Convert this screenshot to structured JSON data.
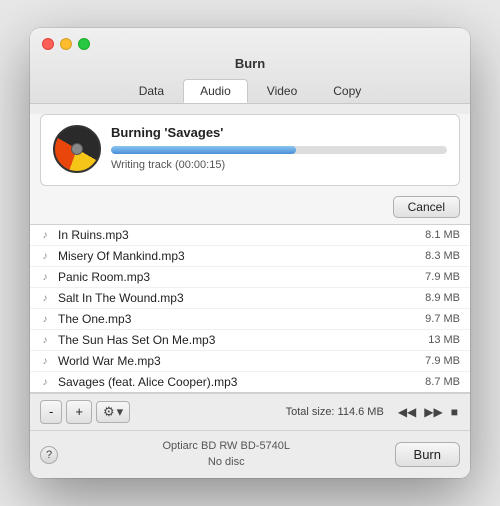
{
  "window": {
    "title": "Burn",
    "tabs": [
      {
        "id": "data",
        "label": "Data",
        "active": false
      },
      {
        "id": "audio",
        "label": "Audio",
        "active": true
      },
      {
        "id": "video",
        "label": "Video",
        "active": false
      },
      {
        "id": "copy",
        "label": "Copy",
        "active": false
      }
    ]
  },
  "burn_progress": {
    "title": "Burning 'Savages'",
    "status": "Writing track (00:00:15)",
    "progress_pct": 55,
    "cancel_label": "Cancel"
  },
  "files": [
    {
      "name": "In Ruins.mp3",
      "size": "8.1 MB"
    },
    {
      "name": "Misery Of Mankind.mp3",
      "size": "8.3 MB"
    },
    {
      "name": "Panic Room.mp3",
      "size": "7.9 MB"
    },
    {
      "name": "Salt In The Wound.mp3",
      "size": "8.9 MB"
    },
    {
      "name": "The One.mp3",
      "size": "9.7 MB"
    },
    {
      "name": "The Sun Has Set On Me.mp3",
      "size": "13 MB"
    },
    {
      "name": "World War Me.mp3",
      "size": "7.9 MB"
    },
    {
      "name": "Savages (feat. Alice Cooper).mp3",
      "size": "8.7 MB"
    }
  ],
  "toolbar": {
    "minus_label": "-",
    "plus_label": "+",
    "gear_label": "⚙",
    "chevron_label": "▾",
    "total_size_label": "Total size: 114.6 MB",
    "rewind_label": "◀◀",
    "skip_label": "▶▶",
    "stop_label": "■"
  },
  "bottom_bar": {
    "help_label": "?",
    "drive_name": "Optiarc BD RW BD-5740L",
    "drive_status": "No disc",
    "burn_button_label": "Burn"
  }
}
